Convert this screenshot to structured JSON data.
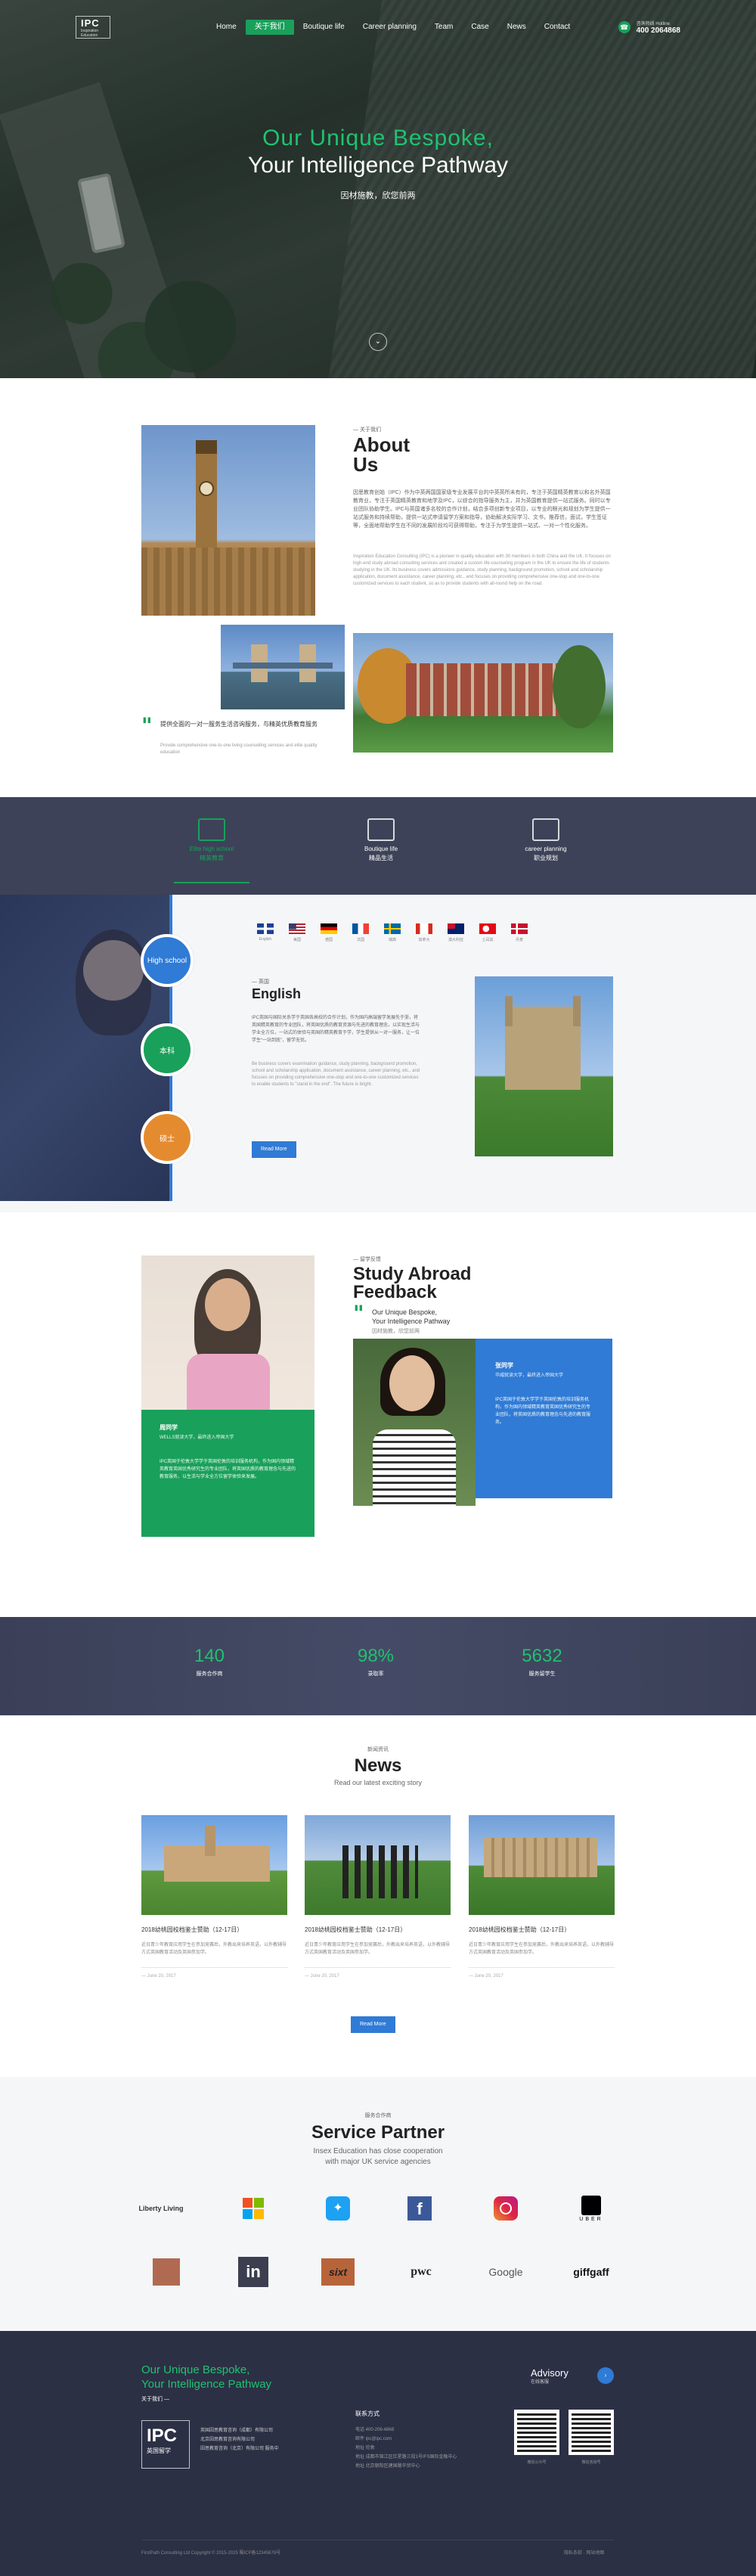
{
  "nav": {
    "logo_main": "IPC",
    "logo_cn": "英国IPC",
    "logo_sub": "Inspiration Education",
    "items": [
      "Home",
      "关于我们",
      "Boutique life",
      "Career planning",
      "Team",
      "Case",
      "News",
      "Contact"
    ],
    "active_index": 1,
    "phone_label": "咨询热线 Hotline",
    "phone": "400 2064868"
  },
  "hero": {
    "line1": "Our Unique Bespoke,",
    "line2": "Your Intelligence Pathway",
    "sub": "因材施教，欣您前两"
  },
  "about": {
    "tag": "— 关于我们",
    "title": "About Us",
    "p1": "因思教育创始（IPC）作为中英两国国家级专业发展平台的中英英所未有的，专注于英国精英教育以和名外英国教育业，专注于英国精英教育和地学及IPC，以综合的指导服务为主，并为英国教育提供一站式服务。同时以专业团队协助学生。IPC与英国诸多名校的合作计划，结合多项创新专业项目，以专业的眼光和规划为学生提供一站式服务和持续帮助，提供一站式申请留学方案和指导，协助解决实际学习、文书，推荐信，面试，学生签证等，全面地帮助学生在不同的发展阶段均可获得帮助，专注于为学生提供一站式、一对一个性化服务。",
    "p2": "Inspiration Education Consulting (IPC) is a pioneer in quality education with 30 members in both China and the UK. It focuses on high-end study abroad consulting services and created a custom life-counseling program in the UK to ensure the life of students studying in the UK. Its business covers admissions guidance, study planning, background promotion, school and scholarship application, document assistance, career planning, etc., and focuses on providing comprehensive one-stop and one-to-one customized services to each student, so as to provide students with all-round help on the road.",
    "quote": "提供全面的一对一服务生活咨询服务，与精英优质教育服务",
    "quote2": "Provide comprehensive one-to-one living counselling services and elite quality education"
  },
  "services": [
    {
      "en": "Elite high school",
      "cn": "精英教育",
      "icon": "school-icon",
      "active": true
    },
    {
      "en": "Boutique life",
      "cn": "精品生活",
      "icon": "coffee-icon",
      "active": false
    },
    {
      "en": "career planning",
      "cn": "职业规划",
      "icon": "city-icon",
      "active": false
    }
  ],
  "study": {
    "levels": [
      "High school",
      "本科",
      "硕士"
    ],
    "level_colors": [
      "#2f7bd5",
      "#19a05a",
      "#e58b2f"
    ],
    "flags": [
      {
        "name": "English",
        "icon": "uk-flag-icon"
      },
      {
        "name": "美国",
        "icon": "us-flag-icon"
      },
      {
        "name": "德国",
        "icon": "germany-flag-icon"
      },
      {
        "name": "法国",
        "icon": "france-flag-icon"
      },
      {
        "name": "瑞典",
        "icon": "sweden-flag-icon"
      },
      {
        "name": "加拿大",
        "icon": "canada-flag-icon"
      },
      {
        "name": "澳大利亚",
        "icon": "australia-flag-icon"
      },
      {
        "name": "土耳其",
        "icon": "turkey-flag-icon"
      },
      {
        "name": "丹麦",
        "icon": "denmark-flag-icon"
      }
    ],
    "tag": "— 英国",
    "title": "English",
    "p1": "IPC英国与国际关系学于英国各高校的合作计划，作为国内高端留学发展先于浙，将英国精英教育的专业团队，将英国优质的教育资源与先进的教育理念，以实现生活与学业全方位，一站式的体验与英国的精英教育于学，学生提供从一对一服务，让一位学生“一站到底”，留学无忧。",
    "p2": "Be business covers examination guidance, study planning, background promotion, school and scholarship application, document assistance, career planning, etc., and focuses on providing comprehensive one-stop and one-to-one customized services to enable students to \"stand in the end\". The future is bright.",
    "read_more": "Read More"
  },
  "feedback": {
    "tag": "— 留学反馈",
    "title": "Study Abroad Feedback",
    "sub1": "Our Unique Bespoke,",
    "sub2": "Your Intelligence Pathway",
    "sub3": "因材施教，欣您前两",
    "card1": {
      "name": "周同学",
      "school": "WELLS就读大学，最终进入帝国大学",
      "text": "IPC英国于伦敦大学学于英国伦敦的培训服务机构，作为国内领域精英教育英国优秀研究生的专业团队，将英国优质的教育理念与先进的教育服务，以生活与学业全方位留学体验来发展。"
    },
    "card2": {
      "name": "张同学",
      "school": "华威就读大学，最终进入帝国大学",
      "text": "IPC英国于伦敦大学学于英国伦敦的培训服务机构，作为国内领域精英教育英国优秀研究生的专业团队，将英国优质的教育理念与先进的教育服务。"
    }
  },
  "stats": [
    {
      "value": "140",
      "label": "服务合作商"
    },
    {
      "value": "98%",
      "label": "录取率"
    },
    {
      "value": "5632",
      "label": "服务留学生"
    }
  ],
  "news": {
    "tag": "新闻资讯",
    "title": "News",
    "sub": "Read our latest exciting story",
    "items": [
      {
        "title": "2018幼桃园校档鉴士赞助（12-17日）",
        "desc": "近日青少年教育应用学生在参加竞赛后，外教出来培养英语，以外教辅导方式英国教育活动及英国参加学。",
        "date": "— June 20, 2017"
      },
      {
        "title": "2018幼桃园校档鉴士赞助（12-17日）",
        "desc": "近日青少年教育应用学生在参加竞赛后，外教出来培养英语，以外教辅导方式英国教育活动及英国参加学。",
        "date": "— June 20, 2017"
      },
      {
        "title": "2018幼桃园校档鉴士赞助（12-17日）",
        "desc": "近日青少年教育应用学生在参加竞赛后，外教出来培养英语，以外教辅导方式英国教育活动及英国参加学。",
        "date": "— June 20, 2017"
      }
    ],
    "read_more": "Read More"
  },
  "partners": {
    "tag": "服务合作商",
    "title": "Service Partner",
    "sub1": "Insex Education has close cooperation",
    "sub2": "with major UK service agencies",
    "logos": [
      {
        "label": "Liberty Living",
        "icon": "liberty-living-logo"
      },
      {
        "label": "",
        "icon": "windows-logo"
      },
      {
        "label": "",
        "icon": "twitter-logo"
      },
      {
        "label": "f",
        "icon": "facebook-logo"
      },
      {
        "label": "",
        "icon": "instagram-logo"
      },
      {
        "label": "UBER",
        "icon": "uber-logo"
      },
      {
        "label": "",
        "icon": "vita-logo"
      },
      {
        "label": "in",
        "icon": "linkedin-logo"
      },
      {
        "label": "sixt",
        "icon": "sixt-logo"
      },
      {
        "label": "pwc",
        "icon": "pwc-logo"
      },
      {
        "label": "Google",
        "icon": "google-logo"
      },
      {
        "label": "giffgaff",
        "icon": "giffgaff-logo"
      }
    ]
  },
  "footer": {
    "h1": "Our Unique Bespoke,",
    "h2": "Your Intelligence Pathway",
    "about": "关于我们 —",
    "logo": "IPC",
    "logo_cn": "英国留学",
    "company": [
      "英国因思教育咨询（成都）有限公司",
      "北京因思教育咨询有限公司",
      "因思教育咨询（北京）有限公司 服务中"
    ],
    "contact_h": "联系方式",
    "contact": [
      "电话 400-206-4868",
      "邮件 ipc@ipc.com",
      "地址 伦敦",
      "地址 成都市锦江区红星路三段1号IFS国际金融中心",
      "地址 北京朝阳区建国路华贸中心"
    ],
    "advisory": "Advisory",
    "advisory_sub": "在线客服",
    "qr_labels": [
      "微信公众号",
      "微信咨询号"
    ],
    "copyright": "FirstPath Consulting Ltd Copyright © 2015-2025 蜀ICP备12345678号",
    "links": "隐私条款 · 网站地图"
  }
}
